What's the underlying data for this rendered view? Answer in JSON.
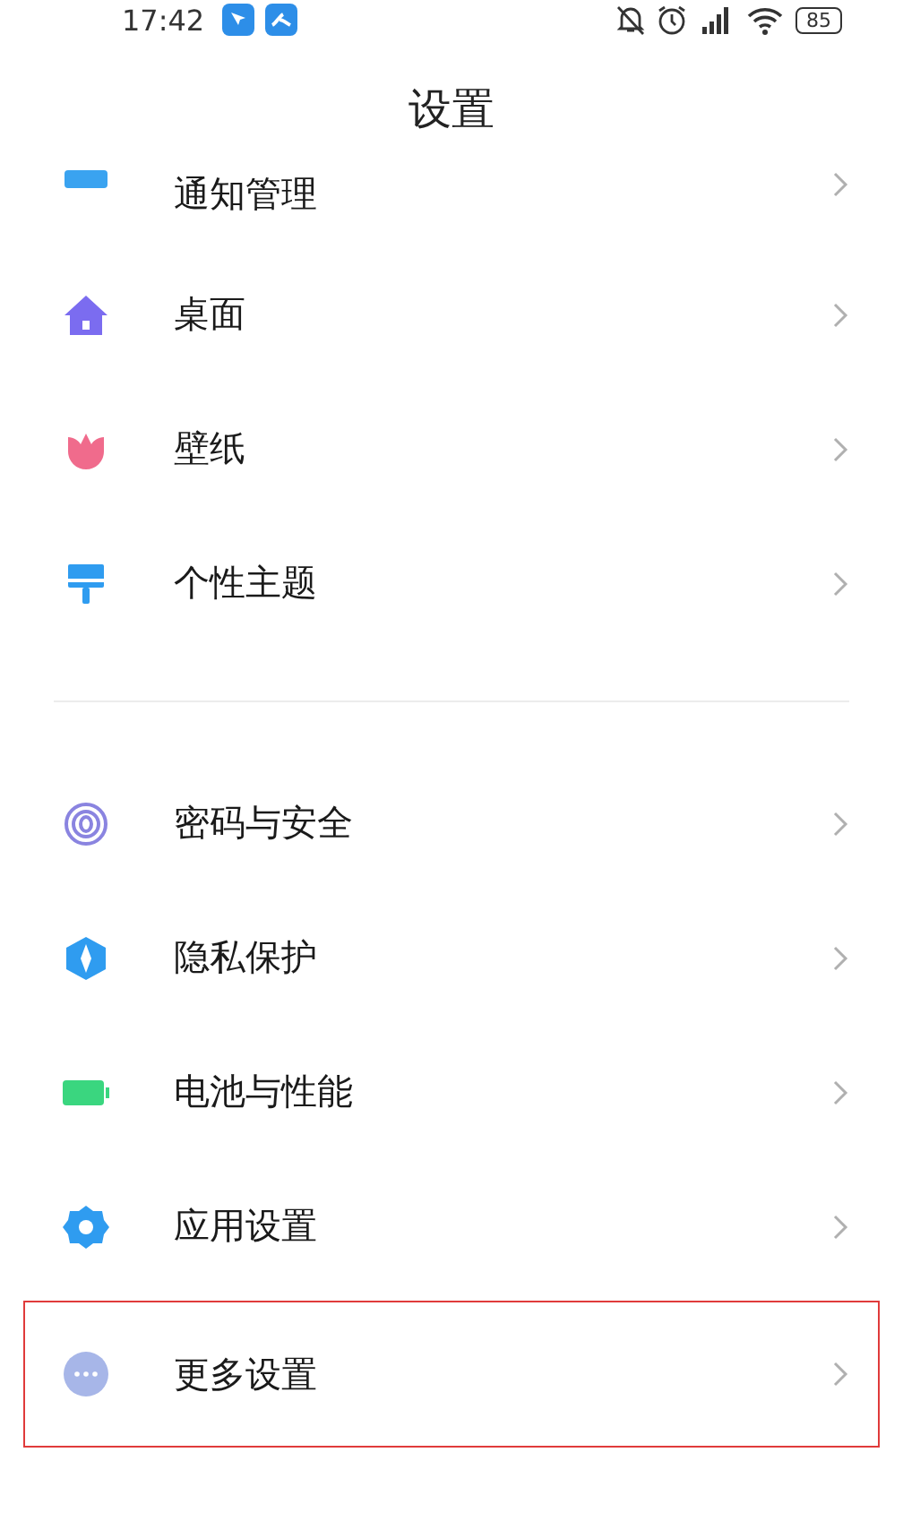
{
  "status_bar": {
    "time": "17:42",
    "battery": "85"
  },
  "header": {
    "title": "设置"
  },
  "groups": [
    {
      "items": [
        {
          "kind": "bar",
          "label": "通知管理",
          "highlighted": false
        },
        {
          "kind": "home",
          "label": "桌面",
          "highlighted": false
        },
        {
          "kind": "tulip",
          "label": "壁纸",
          "highlighted": false
        },
        {
          "kind": "brush",
          "label": "个性主题",
          "highlighted": false
        }
      ]
    },
    {
      "items": [
        {
          "kind": "fingerprint",
          "label": "密码与安全",
          "highlighted": false
        },
        {
          "kind": "shield",
          "label": "隐私保护",
          "highlighted": false
        },
        {
          "kind": "battery",
          "label": "电池与性能",
          "highlighted": false
        },
        {
          "kind": "gear",
          "label": "应用设置",
          "highlighted": false
        },
        {
          "kind": "dots",
          "label": "更多设置",
          "highlighted": true
        }
      ]
    }
  ]
}
